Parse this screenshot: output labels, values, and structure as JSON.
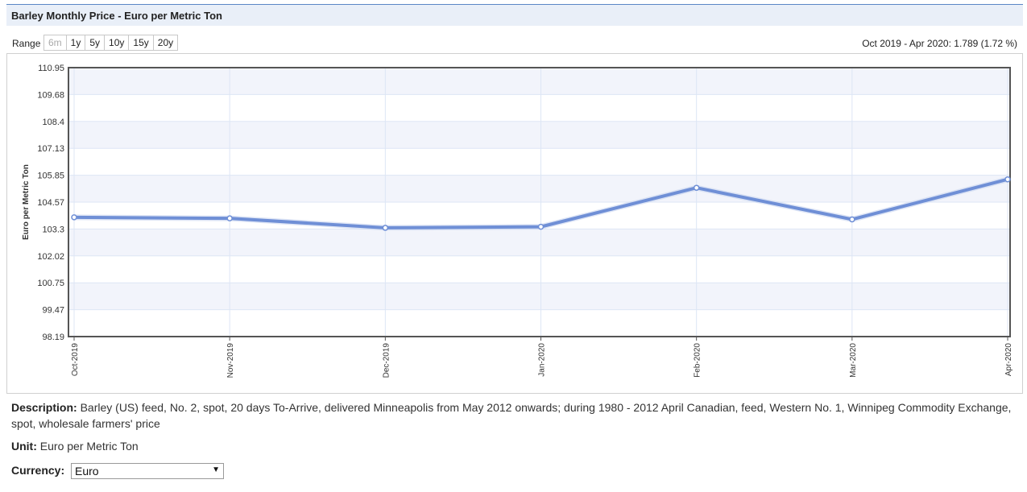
{
  "title": "Barley Monthly Price - Euro per Metric Ton",
  "range": {
    "label": "Range",
    "buttons": [
      "6m",
      "1y",
      "5y",
      "10y",
      "15y",
      "20y"
    ],
    "disabled": "6m"
  },
  "change_text": "Oct 2019 - Apr 2020: 1.789 (1.72 %)",
  "description": {
    "label": "Description:",
    "text": "Barley (US) feed, No. 2, spot, 20 days To-Arrive, delivered Minneapolis from May 2012 onwards; during 1980 - 2012 April Canadian, feed, Western No. 1, Winnipeg Commodity Exchange, spot, wholesale farmers' price"
  },
  "unit": {
    "label": "Unit:",
    "value": "Euro per Metric Ton"
  },
  "currency": {
    "label": "Currency:",
    "value": "Euro"
  },
  "colors": {
    "line": "#6f8fd6",
    "band": "#f2f4fb",
    "grid": "#dde6f5",
    "axis": "#555555"
  },
  "chart_data": {
    "type": "line",
    "title": "",
    "xlabel": "",
    "ylabel": "Euro per Metric Ton",
    "categories": [
      "Oct-2019",
      "Nov-2019",
      "Dec-2019",
      "Jan-2020",
      "Feb-2020",
      "Mar-2020",
      "Apr-2020"
    ],
    "series": [
      {
        "values": [
          103.85,
          103.8,
          103.35,
          103.4,
          105.25,
          103.75,
          105.65
        ]
      }
    ],
    "yticks": [
      "110.95",
      "109.68",
      "108.4",
      "107.13",
      "105.85",
      "104.57",
      "103.3",
      "102.02",
      "100.75",
      "99.47",
      "98.19"
    ],
    "ylim": [
      98.19,
      110.95
    ],
    "grid": true,
    "legend": "none"
  }
}
